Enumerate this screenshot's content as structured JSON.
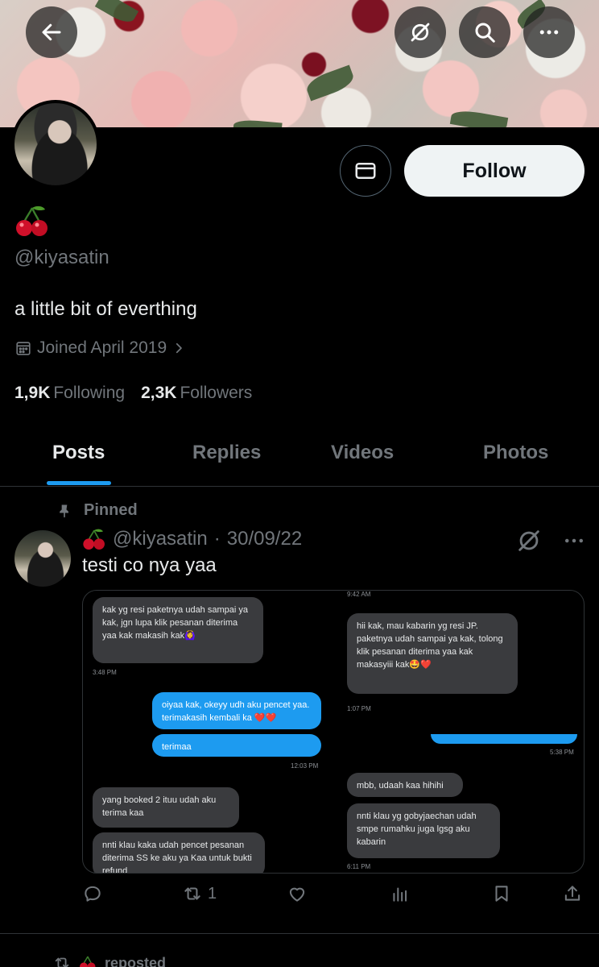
{
  "topbar": {
    "back_icon": "arrow-left-icon",
    "grok_icon": "slashed-circle-icon",
    "search_icon": "search-icon",
    "more_icon": "more-horizontal-icon"
  },
  "profile": {
    "display_name": "🍒",
    "handle": "@kiyasatin",
    "bio": "a little bit of everthing",
    "joined": "Joined April 2019",
    "following_count": "1,9K",
    "following_label": "Following",
    "followers_count": "2,3K",
    "followers_label": "Followers",
    "follow_label": "Follow",
    "message_icon": "envelope-icon"
  },
  "tabs": [
    {
      "label": "Posts",
      "active": true
    },
    {
      "label": "Replies",
      "active": false
    },
    {
      "label": "Videos",
      "active": false
    },
    {
      "label": "Photos",
      "active": false
    }
  ],
  "post": {
    "pinned_label": "Pinned",
    "author_name": "🍒",
    "author_handle": "@kiyasatin",
    "separator": "·",
    "date": "30/09/22",
    "text": "testi co nya yaa",
    "repost_count": "1",
    "media": {
      "left": {
        "bubbles": [
          {
            "dir": "in",
            "text": "kak yg resi\npaketnya udah sampai ya kak, jgn lupa klik pesanan diterima yaa kak makasih kak🙆‍♀️"
          },
          {
            "dir": "out",
            "text": "oiyaa kak, okeyy udh aku pencet yaa. terimakasih kembali ka ❤️❤️"
          },
          {
            "dir": "out",
            "text": "terimaa"
          },
          {
            "dir": "in",
            "text": "yang booked 2 ituu udah aku terima kaa"
          },
          {
            "dir": "in",
            "text": "nnti klau kaka udah pencet pesanan diterima SS ke aku ya Kaa untuk bukti refund"
          }
        ],
        "timestamps": [
          "3:48 PM",
          "12:03 PM"
        ]
      },
      "right": {
        "bubbles": [
          {
            "dir": "in",
            "text": "hii kak, mau kabarin yg resi JP.                 paketnya udah sampai ya kak, tolong klik pesanan diterima yaa kak makasyiii kak🤩❤️"
          },
          {
            "dir": "in",
            "text": "mbb, udaah kaa hihihi"
          },
          {
            "dir": "in",
            "text": "nnti klau yg gobyjaechan udah smpe rumahku juga lgsg aku kabarin"
          }
        ],
        "timestamps": [
          "9:42 AM",
          "1:07 PM",
          "5:38 PM",
          "6:11 PM"
        ]
      }
    }
  },
  "next_post": {
    "reposted_label": "reposted",
    "reposter_name": "🍒"
  },
  "colors": {
    "accent": "#1d9bf0",
    "background": "#000000",
    "muted": "#71767b",
    "text": "#e7e9ea",
    "cherry": "#d0102a"
  }
}
